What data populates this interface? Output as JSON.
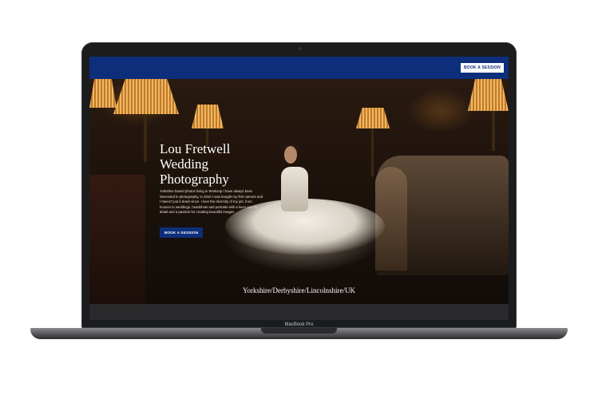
{
  "device": {
    "label": "MacBook Pro"
  },
  "nav": {
    "cta_label": "BOOK A SESSION",
    "background": "#0d2e7a"
  },
  "hero": {
    "title": "Lou Fretwell Wedding Photography",
    "description": "Yorkshire based photos living in Worksop I have always been interested in photography, in 2010 I was bought my first camera and I haven't put it down since. I love the diversity of my job, from houses to weddings, headshots and portraits with a keen eye for detail and a passion for creating beautiful images",
    "cta_label": "BOOK A SESSION",
    "location": "Yorkshire/Derbyshire/Lincolnshire/UK"
  },
  "colors": {
    "accent": "#0d2e7a",
    "text_light": "#ffffff"
  }
}
